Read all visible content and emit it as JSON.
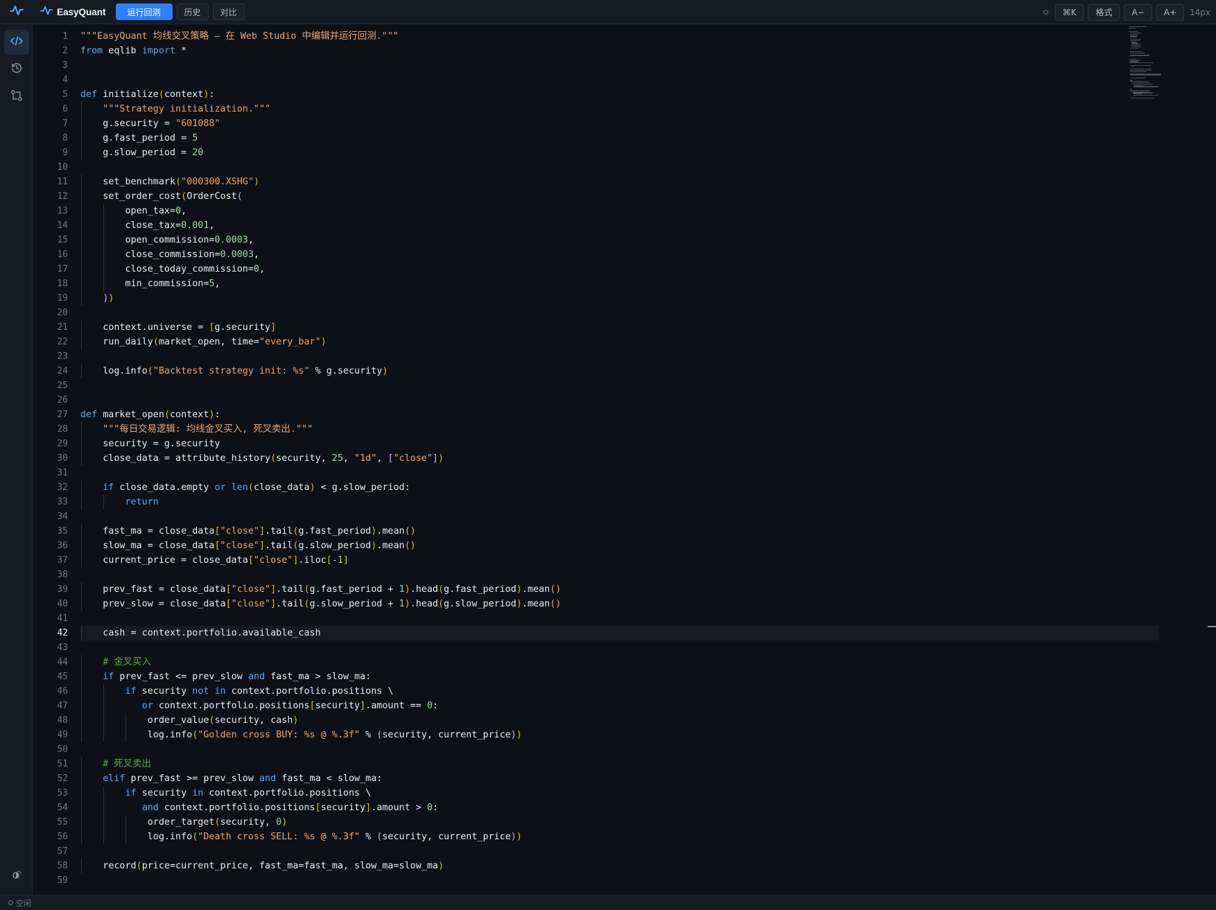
{
  "app": {
    "name": "EasyQuant",
    "accent": "#2f81f7"
  },
  "toolbar": {
    "run_backtest_label": "运行回测",
    "history_label": "历史",
    "compare_label": "对比",
    "shortcut_label": "⌘K",
    "format_label": "格式",
    "font_decrease_label": "A−",
    "font_increase_label": "A+",
    "font_size": "14px"
  },
  "sidebar": {
    "items": [
      {
        "icon": "code-icon",
        "active": true
      },
      {
        "icon": "history-icon",
        "active": false
      },
      {
        "icon": "compare-icon",
        "active": false
      }
    ],
    "bottom_icon": "theme-toggle-icon"
  },
  "editor": {
    "current_line": 42,
    "lines": [
      [
        [
          "s",
          "\"\"\"EasyQuant 均线交叉策略 — 在 Web Studio 中编辑并运行回测.\"\"\""
        ]
      ],
      [
        [
          "k",
          "from"
        ],
        [
          "n",
          " eqlib "
        ],
        [
          "k",
          "import"
        ],
        [
          "n",
          " *"
        ]
      ],
      [],
      [],
      [
        [
          "k",
          "def"
        ],
        [
          "n",
          " initialize"
        ],
        [
          "b1",
          "("
        ],
        [
          "n",
          "context"
        ],
        [
          "b1",
          ")"
        ],
        [
          "n",
          ":"
        ]
      ],
      [
        [
          "n",
          "    "
        ],
        [
          "s",
          "\"\"\"Strategy initialization.\"\"\""
        ]
      ],
      [
        [
          "n",
          "    g.security = "
        ],
        [
          "s",
          "\"601088\""
        ]
      ],
      [
        [
          "n",
          "    g.fast_period = "
        ],
        [
          "num",
          "5"
        ]
      ],
      [
        [
          "n",
          "    g.slow_period = "
        ],
        [
          "num",
          "20"
        ]
      ],
      [],
      [
        [
          "n",
          "    set_benchmark"
        ],
        [
          "b1",
          "("
        ],
        [
          "s",
          "\"000300.XSHG\""
        ],
        [
          "b1",
          ")"
        ]
      ],
      [
        [
          "n",
          "    set_order_cost"
        ],
        [
          "b1",
          "("
        ],
        [
          "n",
          "OrderCost"
        ],
        [
          "b2",
          "("
        ]
      ],
      [
        [
          "n",
          "        open_tax="
        ],
        [
          "num",
          "0"
        ],
        [
          "n",
          ","
        ]
      ],
      [
        [
          "n",
          "        close_tax="
        ],
        [
          "num",
          "0.001"
        ],
        [
          "n",
          ","
        ]
      ],
      [
        [
          "n",
          "        open_commission="
        ],
        [
          "num",
          "0.0003"
        ],
        [
          "n",
          ","
        ]
      ],
      [
        [
          "n",
          "        close_commission="
        ],
        [
          "num",
          "0.0003"
        ],
        [
          "n",
          ","
        ]
      ],
      [
        [
          "n",
          "        close_today_commission="
        ],
        [
          "num",
          "0"
        ],
        [
          "n",
          ","
        ]
      ],
      [
        [
          "n",
          "        min_commission="
        ],
        [
          "num",
          "5"
        ],
        [
          "n",
          ","
        ]
      ],
      [
        [
          "n",
          "    "
        ],
        [
          "b2",
          ")"
        ],
        [
          "b1",
          ")"
        ]
      ],
      [],
      [
        [
          "n",
          "    context.universe = "
        ],
        [
          "b1",
          "["
        ],
        [
          "n",
          "g.security"
        ],
        [
          "b1",
          "]"
        ]
      ],
      [
        [
          "n",
          "    run_daily"
        ],
        [
          "b1",
          "("
        ],
        [
          "n",
          "market_open, time="
        ],
        [
          "s",
          "\"every_bar\""
        ],
        [
          "b1",
          ")"
        ]
      ],
      [],
      [
        [
          "n",
          "    log.info"
        ],
        [
          "b1",
          "("
        ],
        [
          "s",
          "\"Backtest strategy init: %s\""
        ],
        [
          "n",
          " % g.security"
        ],
        [
          "b1",
          ")"
        ]
      ],
      [],
      [],
      [
        [
          "k",
          "def"
        ],
        [
          "n",
          " market_open"
        ],
        [
          "b1",
          "("
        ],
        [
          "n",
          "context"
        ],
        [
          "b1",
          ")"
        ],
        [
          "n",
          ":"
        ]
      ],
      [
        [
          "n",
          "    "
        ],
        [
          "s",
          "\"\"\"每日交易逻辑: 均线金叉买入, 死叉卖出.\"\"\""
        ]
      ],
      [
        [
          "n",
          "    security = g.security"
        ]
      ],
      [
        [
          "n",
          "    close_data = attribute_history"
        ],
        [
          "b1",
          "("
        ],
        [
          "n",
          "security, "
        ],
        [
          "num",
          "25"
        ],
        [
          "n",
          ", "
        ],
        [
          "s",
          "\"1d\""
        ],
        [
          "n",
          ", "
        ],
        [
          "b2",
          "["
        ],
        [
          "s",
          "\"close\""
        ],
        [
          "b2",
          "]"
        ],
        [
          "b1",
          ")"
        ]
      ],
      [],
      [
        [
          "n",
          "    "
        ],
        [
          "k",
          "if"
        ],
        [
          "n",
          " close_data.empty "
        ],
        [
          "k",
          "or"
        ],
        [
          "n",
          " "
        ],
        [
          "k",
          "len"
        ],
        [
          "b1",
          "("
        ],
        [
          "n",
          "close_data"
        ],
        [
          "b1",
          ")"
        ],
        [
          "n",
          " < g.slow_period:"
        ]
      ],
      [
        [
          "n",
          "        "
        ],
        [
          "k",
          "return"
        ]
      ],
      [],
      [
        [
          "n",
          "    fast_ma = close_data"
        ],
        [
          "b1",
          "["
        ],
        [
          "s",
          "\"close\""
        ],
        [
          "b1",
          "]"
        ],
        [
          "n",
          ".tail"
        ],
        [
          "b1",
          "("
        ],
        [
          "n",
          "g.fast_period"
        ],
        [
          "b1",
          ")"
        ],
        [
          "n",
          ".mean"
        ],
        [
          "b1",
          "()"
        ]
      ],
      [
        [
          "n",
          "    slow_ma = close_data"
        ],
        [
          "b1",
          "["
        ],
        [
          "s",
          "\"close\""
        ],
        [
          "b1",
          "]"
        ],
        [
          "n",
          ".tail"
        ],
        [
          "b1",
          "("
        ],
        [
          "n",
          "g.slow_period"
        ],
        [
          "b1",
          ")"
        ],
        [
          "n",
          ".mean"
        ],
        [
          "b1",
          "()"
        ]
      ],
      [
        [
          "n",
          "    current_price = close_data"
        ],
        [
          "b1",
          "["
        ],
        [
          "s",
          "\"close\""
        ],
        [
          "b1",
          "]"
        ],
        [
          "n",
          ".iloc"
        ],
        [
          "b1",
          "["
        ],
        [
          "num",
          "-1"
        ],
        [
          "b1",
          "]"
        ]
      ],
      [],
      [
        [
          "n",
          "    prev_fast = close_data"
        ],
        [
          "b1",
          "["
        ],
        [
          "s",
          "\"close\""
        ],
        [
          "b1",
          "]"
        ],
        [
          "n",
          ".tail"
        ],
        [
          "b1",
          "("
        ],
        [
          "n",
          "g.fast_period + "
        ],
        [
          "num",
          "1"
        ],
        [
          "b1",
          ")"
        ],
        [
          "n",
          ".head"
        ],
        [
          "b1",
          "("
        ],
        [
          "n",
          "g.fast_period"
        ],
        [
          "b1",
          ")"
        ],
        [
          "n",
          ".mean"
        ],
        [
          "b1",
          "()"
        ]
      ],
      [
        [
          "n",
          "    prev_slow = close_data"
        ],
        [
          "b1",
          "["
        ],
        [
          "s",
          "\"close\""
        ],
        [
          "b1",
          "]"
        ],
        [
          "n",
          ".tail"
        ],
        [
          "b1",
          "("
        ],
        [
          "n",
          "g.slow_period + "
        ],
        [
          "num",
          "1"
        ],
        [
          "b1",
          ")"
        ],
        [
          "n",
          ".head"
        ],
        [
          "b1",
          "("
        ],
        [
          "n",
          "g.slow_period"
        ],
        [
          "b1",
          ")"
        ],
        [
          "n",
          ".mean"
        ],
        [
          "b1",
          "()"
        ]
      ],
      [],
      [
        [
          "n",
          "    cash = context.portfolio.available_cash"
        ]
      ],
      [],
      [
        [
          "n",
          "    "
        ],
        [
          "c",
          "# 金叉买入"
        ]
      ],
      [
        [
          "n",
          "    "
        ],
        [
          "k",
          "if"
        ],
        [
          "n",
          " prev_fast <= prev_slow "
        ],
        [
          "k",
          "and"
        ],
        [
          "n",
          " fast_ma > slow_ma:"
        ]
      ],
      [
        [
          "n",
          "        "
        ],
        [
          "k",
          "if"
        ],
        [
          "n",
          " security "
        ],
        [
          "k",
          "not in"
        ],
        [
          "n",
          " context.portfolio.positions \\"
        ]
      ],
      [
        [
          "n",
          "           "
        ],
        [
          "k",
          "or"
        ],
        [
          "n",
          " context.portfolio.positions"
        ],
        [
          "b1",
          "["
        ],
        [
          "n",
          "security"
        ],
        [
          "b1",
          "]"
        ],
        [
          "n",
          ".amount == "
        ],
        [
          "num",
          "0"
        ],
        [
          "n",
          ":"
        ]
      ],
      [
        [
          "n",
          "            order_value"
        ],
        [
          "b1",
          "("
        ],
        [
          "n",
          "security, cash"
        ],
        [
          "b1",
          ")"
        ]
      ],
      [
        [
          "n",
          "            log.info"
        ],
        [
          "b1",
          "("
        ],
        [
          "s",
          "\"Golden cross BUY: %s @ %.3f\""
        ],
        [
          "n",
          " % "
        ],
        [
          "b2",
          "("
        ],
        [
          "n",
          "security, current_price"
        ],
        [
          "b2",
          ")"
        ],
        [
          "b1",
          ")"
        ]
      ],
      [],
      [
        [
          "n",
          "    "
        ],
        [
          "c",
          "# 死叉卖出"
        ]
      ],
      [
        [
          "n",
          "    "
        ],
        [
          "k",
          "elif"
        ],
        [
          "n",
          " prev_fast >= prev_slow "
        ],
        [
          "k",
          "and"
        ],
        [
          "n",
          " fast_ma < slow_ma:"
        ]
      ],
      [
        [
          "n",
          "        "
        ],
        [
          "k",
          "if"
        ],
        [
          "n",
          " security "
        ],
        [
          "k",
          "in"
        ],
        [
          "n",
          " context.portfolio.positions \\"
        ]
      ],
      [
        [
          "n",
          "           "
        ],
        [
          "k",
          "and"
        ],
        [
          "n",
          " context.portfolio.positions"
        ],
        [
          "b1",
          "["
        ],
        [
          "n",
          "security"
        ],
        [
          "b1",
          "]"
        ],
        [
          "n",
          ".amount > "
        ],
        [
          "num",
          "0"
        ],
        [
          "n",
          ":"
        ]
      ],
      [
        [
          "n",
          "            order_target"
        ],
        [
          "b1",
          "("
        ],
        [
          "n",
          "security, "
        ],
        [
          "num",
          "0"
        ],
        [
          "b1",
          ")"
        ]
      ],
      [
        [
          "n",
          "            log.info"
        ],
        [
          "b1",
          "("
        ],
        [
          "s",
          "\"Death cross SELL: %s @ %.3f\""
        ],
        [
          "n",
          " % "
        ],
        [
          "b2",
          "("
        ],
        [
          "n",
          "security, current_price"
        ],
        [
          "b2",
          ")"
        ],
        [
          "b1",
          ")"
        ]
      ],
      [],
      [
        [
          "n",
          "    record"
        ],
        [
          "b1",
          "("
        ],
        [
          "n",
          "price=current_price, fast_ma=fast_ma, slow_ma=slow_ma"
        ],
        [
          "b1",
          ")"
        ]
      ],
      []
    ]
  },
  "status": {
    "label": "空闲"
  }
}
